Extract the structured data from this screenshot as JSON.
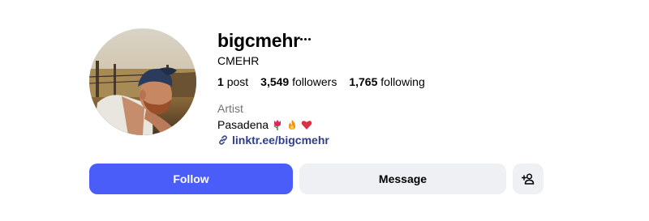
{
  "profile": {
    "username": "bigcmehr",
    "full_name": "CMEHR",
    "stats": {
      "posts_count": "1",
      "posts_label": "post",
      "followers_count": "3,549",
      "followers_label": "followers",
      "following_count": "1,765",
      "following_label": "following"
    },
    "category": "Artist",
    "bio": "Pasadena",
    "bio_emojis": [
      "tulip",
      "fire",
      "red-heart"
    ],
    "link": "linktr.ee/bigcmehr"
  },
  "actions": {
    "follow_label": "Follow",
    "message_label": "Message"
  },
  "colors": {
    "follow_button": "#4a5df9",
    "secondary_button": "#eff0f3",
    "link": "#2f3e8c",
    "category_text": "#737373"
  },
  "icons": {
    "more": "more-options-icon",
    "link": "link-icon",
    "suggest": "add-user-icon"
  }
}
